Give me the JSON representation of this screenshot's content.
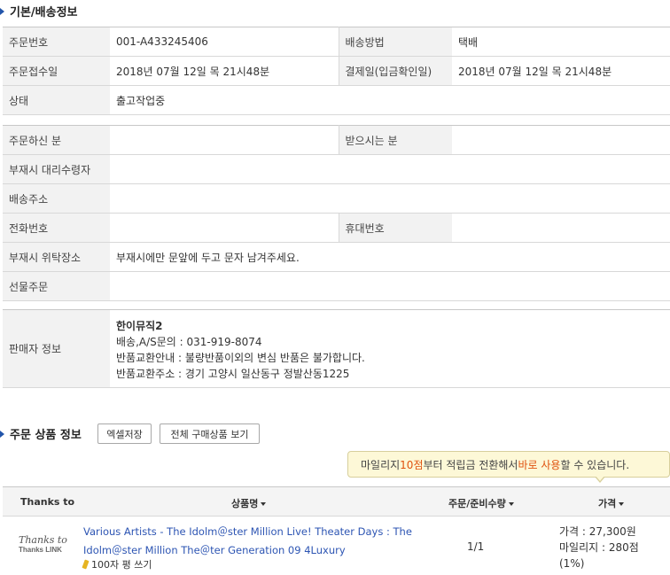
{
  "sections": {
    "basic_title": "기본/배송정보",
    "product_title": "주문 상품 정보"
  },
  "order": {
    "number_label": "주문번호",
    "number_value": "001-A433245406",
    "method_label": "배송방법",
    "method_value": "택배",
    "received_label": "주문접수일",
    "received_value": "2018년 07월 12일 목 21시48분",
    "paid_label": "결제일(입금확인일)",
    "paid_value": "2018년 07월 12일 목 21시48분",
    "status_label": "상태",
    "status_value": "출고작업중"
  },
  "delivery": {
    "orderer_label": "주문하신 분",
    "orderer_value": "",
    "receiver_label": "받으시는 분",
    "receiver_value": "",
    "proxy_label": "부재시 대리수령자",
    "proxy_value": "",
    "address_label": "배송주소",
    "address_value": "",
    "phone_label": "전화번호",
    "phone_value": "",
    "mobile_label": "휴대번호",
    "mobile_value": "",
    "consign_label": "부재시 위탁장소",
    "consign_value": "부재시에만 문앞에 두고 문자 남겨주세요.",
    "gift_label": "선물주문",
    "gift_value": ""
  },
  "seller": {
    "label": "판매자 정보",
    "name": "한이뮤직2",
    "contact": "배송,A/S문의 : 031-919-8074",
    "exchange_info": "반품교환안내 : 불량반품이외의 변심 반품은 불가합니다.",
    "exchange_address": "반품교환주소 : 경기 고양시 일산동구 정발산동1225"
  },
  "buttons": {
    "excel": "엑셀저장",
    "view_all": "전체 구매상품 보기"
  },
  "tooltip": {
    "part1": "마일리지 ",
    "highlight1": "10점",
    "part2": "부터 적립금 전환해서 ",
    "highlight2": "바로 사용",
    "part3": "할 수 있습니다."
  },
  "columns": {
    "thanks": "Thanks to",
    "product": "상품명",
    "qty": "주문/준비수량",
    "price": "가격"
  },
  "item": {
    "thanks_logo_top": "Thanks to",
    "thanks_logo_bottom": "Thanks LINK",
    "title_line1": "Various Artists - The Idolm＠ster Million Live! Theater Days : The",
    "title_line2": "Idolm＠ster Million The＠ter Generation 09 4Luxury",
    "review": "100자 평 쓰기",
    "qty": "1/1",
    "price": "가격 : 27,300원",
    "mileage": "마일리지 : 280점",
    "mileage_pct": "(1%)"
  }
}
